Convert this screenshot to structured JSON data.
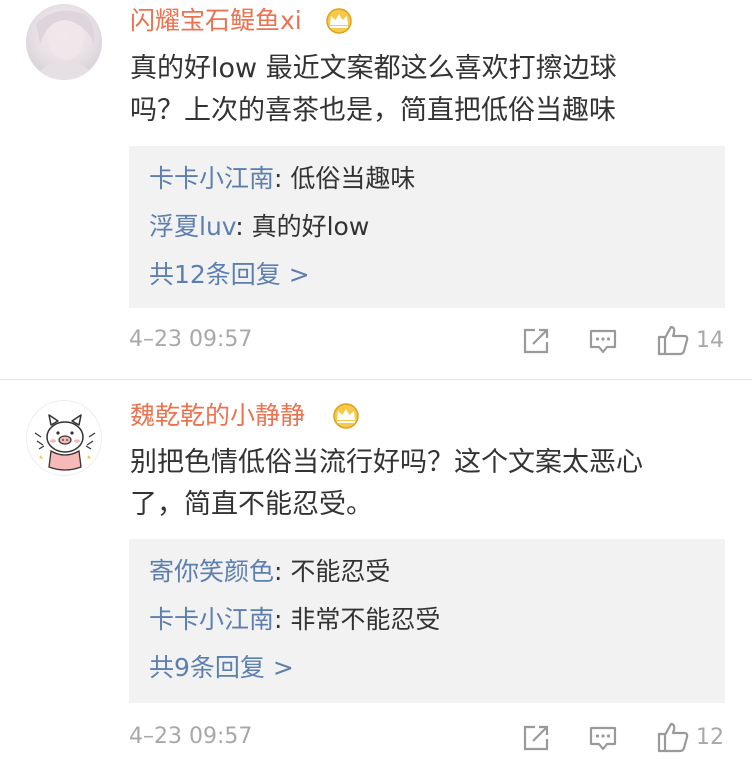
{
  "comments": [
    {
      "username": "闪耀宝石鳀鱼xi",
      "text_lines": [
        "真的好low 最近文案都这么喜欢打擦边球",
        "吗？上次的喜茶也是，简直把低俗当趣味"
      ],
      "replies": [
        {
          "name": "卡卡小江南",
          "text": ": 低俗当趣味"
        },
        {
          "name": "浮夏luv",
          "text": ": 真的好low"
        }
      ],
      "more_replies": "共12条回复 >",
      "timestamp": "4–23 09:57",
      "like_count": "14"
    },
    {
      "username": "魏乾乾的小静静",
      "text_lines": [
        "别把色情低俗当流行好吗？这个文案太恶心",
        "了，简直不能忍受。"
      ],
      "replies": [
        {
          "name": "寄你笑颜色",
          "text": ": 不能忍受"
        },
        {
          "name": "卡卡小江南",
          "text": ": 非常不能忍受"
        }
      ],
      "more_replies": "共9条回复 >",
      "timestamp": "4–23 09:57",
      "like_count": "12"
    }
  ],
  "colors": {
    "username": "#eb7350",
    "reply_name": "#5d7fb0",
    "meta": "#a8a8a8",
    "reply_bg": "#f2f2f2"
  },
  "icons": {
    "badge": "crown-icon",
    "share": "share-icon",
    "comment": "comment-icon",
    "like": "like-icon"
  }
}
